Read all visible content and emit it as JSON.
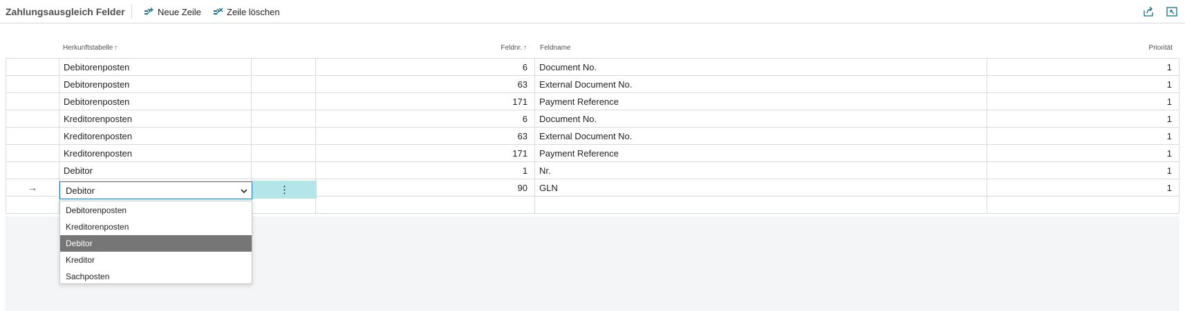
{
  "page": {
    "title": "Zahlungsausgleich Felder",
    "actions": [
      {
        "label": "Neue Zeile",
        "icon": "new-line-icon"
      },
      {
        "label": "Zeile löschen",
        "icon": "delete-line-icon"
      }
    ],
    "share_icon": "share-icon",
    "collapse_icon": "collapse-icon"
  },
  "columns": {
    "source_table": "Herkunftstabelle",
    "field_no": "Feldnr.",
    "field_name": "Feldname",
    "priority": "Priorität",
    "sort_icon": "↑"
  },
  "rows": [
    {
      "source": "Debitorenposten",
      "field_no": "6",
      "field_name": "Document No.",
      "priority": "1"
    },
    {
      "source": "Debitorenposten",
      "field_no": "63",
      "field_name": "External Document No.",
      "priority": "1"
    },
    {
      "source": "Debitorenposten",
      "field_no": "171",
      "field_name": "Payment Reference",
      "priority": "1"
    },
    {
      "source": "Kreditorenposten",
      "field_no": "6",
      "field_name": "Document No.",
      "priority": "1"
    },
    {
      "source": "Kreditorenposten",
      "field_no": "63",
      "field_name": "External Document No.",
      "priority": "1"
    },
    {
      "source": "Kreditorenposten",
      "field_no": "171",
      "field_name": "Payment Reference",
      "priority": "1"
    },
    {
      "source": "Debitor",
      "field_no": "1",
      "field_name": "Nr.",
      "priority": "1"
    }
  ],
  "current_row": {
    "indicator": "→",
    "source": "Debitor",
    "menu_glyph": "⋮",
    "field_no": "90",
    "field_name": "GLN",
    "priority": "1"
  },
  "dropdown": {
    "options": [
      "Debitorenposten",
      "Kreditorenposten",
      "Debitor",
      "Kreditor",
      "Sachposten"
    ],
    "selected": "Debitor"
  },
  "colors": {
    "accent": "#1f6fad",
    "teal_highlight": "#b4e6e9",
    "selected_option": "#767676",
    "icon": "#0f6d89"
  }
}
